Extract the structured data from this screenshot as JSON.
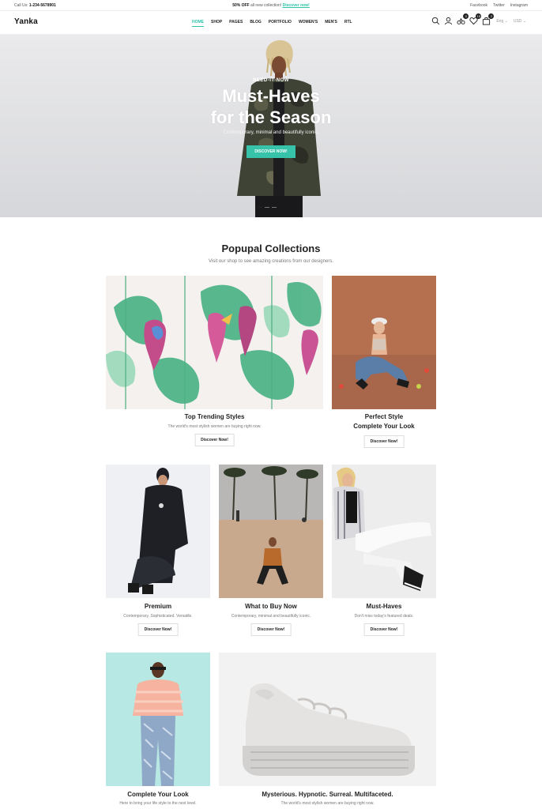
{
  "topbar": {
    "call_label": "Call Us:",
    "phone": "1-234-5678901",
    "promo_bold": "50% OFF",
    "promo_text": "all new collection!",
    "promo_link": "Discover now!",
    "social": [
      "Facebook",
      "Twitter",
      "Instagram"
    ]
  },
  "header": {
    "logo": "Yanka",
    "nav": [
      "HOME",
      "SHOP",
      "PAGES",
      "BLOG",
      "PORTFOLIO",
      "WOMEN'S",
      "MEN'S",
      "RTL"
    ],
    "active_nav": "HOME",
    "badges": {
      "compare": "0",
      "wishlist": "15",
      "cart": "2"
    },
    "language": "Eng",
    "currency": "USD",
    "icons": [
      "search-icon",
      "user-icon",
      "compare-icon",
      "heart-icon",
      "bag-icon"
    ]
  },
  "hero": {
    "eyebrow": "NEED-IT-NOW",
    "title_line1": "Must-Haves",
    "title_line2": "for the Season",
    "subtitle": "Contemporary, minimal and beautifully iconic.",
    "button": "DISCOVER NOW!"
  },
  "collections": {
    "title": "Popupal Collections",
    "subtitle": "Visit our shop to see amazing creations from our designers.",
    "cards": [
      {
        "title": "Top Trending Styles",
        "desc": "The world's most stylish women are buying right now.",
        "button": "Discover Now!"
      },
      {
        "title_line1": "Perfect Style",
        "title_line2": "Complete Your Look",
        "button": "Discover Now!"
      },
      {
        "title": "Premium",
        "desc": "Contemporary. Sophisticated. Versatile.",
        "button": "Discover Now!"
      },
      {
        "title": "What to Buy Now",
        "desc": "Contemporary, minimal and beautifully iconic.",
        "button": "Discover Now!"
      },
      {
        "title": "Must-Haves",
        "desc": "Don't miss today's featured deals.",
        "button": "Discover Now!"
      },
      {
        "title": "Complete Your Look",
        "desc": "Here to bring your life style to the next level."
      },
      {
        "title": "Mysterious. Hypnotic. Surreal. Multifaceted.",
        "desc": "The world's most stylish women are buying right now."
      }
    ]
  },
  "colors": {
    "accent": "#37c3a9",
    "text": "#222222"
  }
}
